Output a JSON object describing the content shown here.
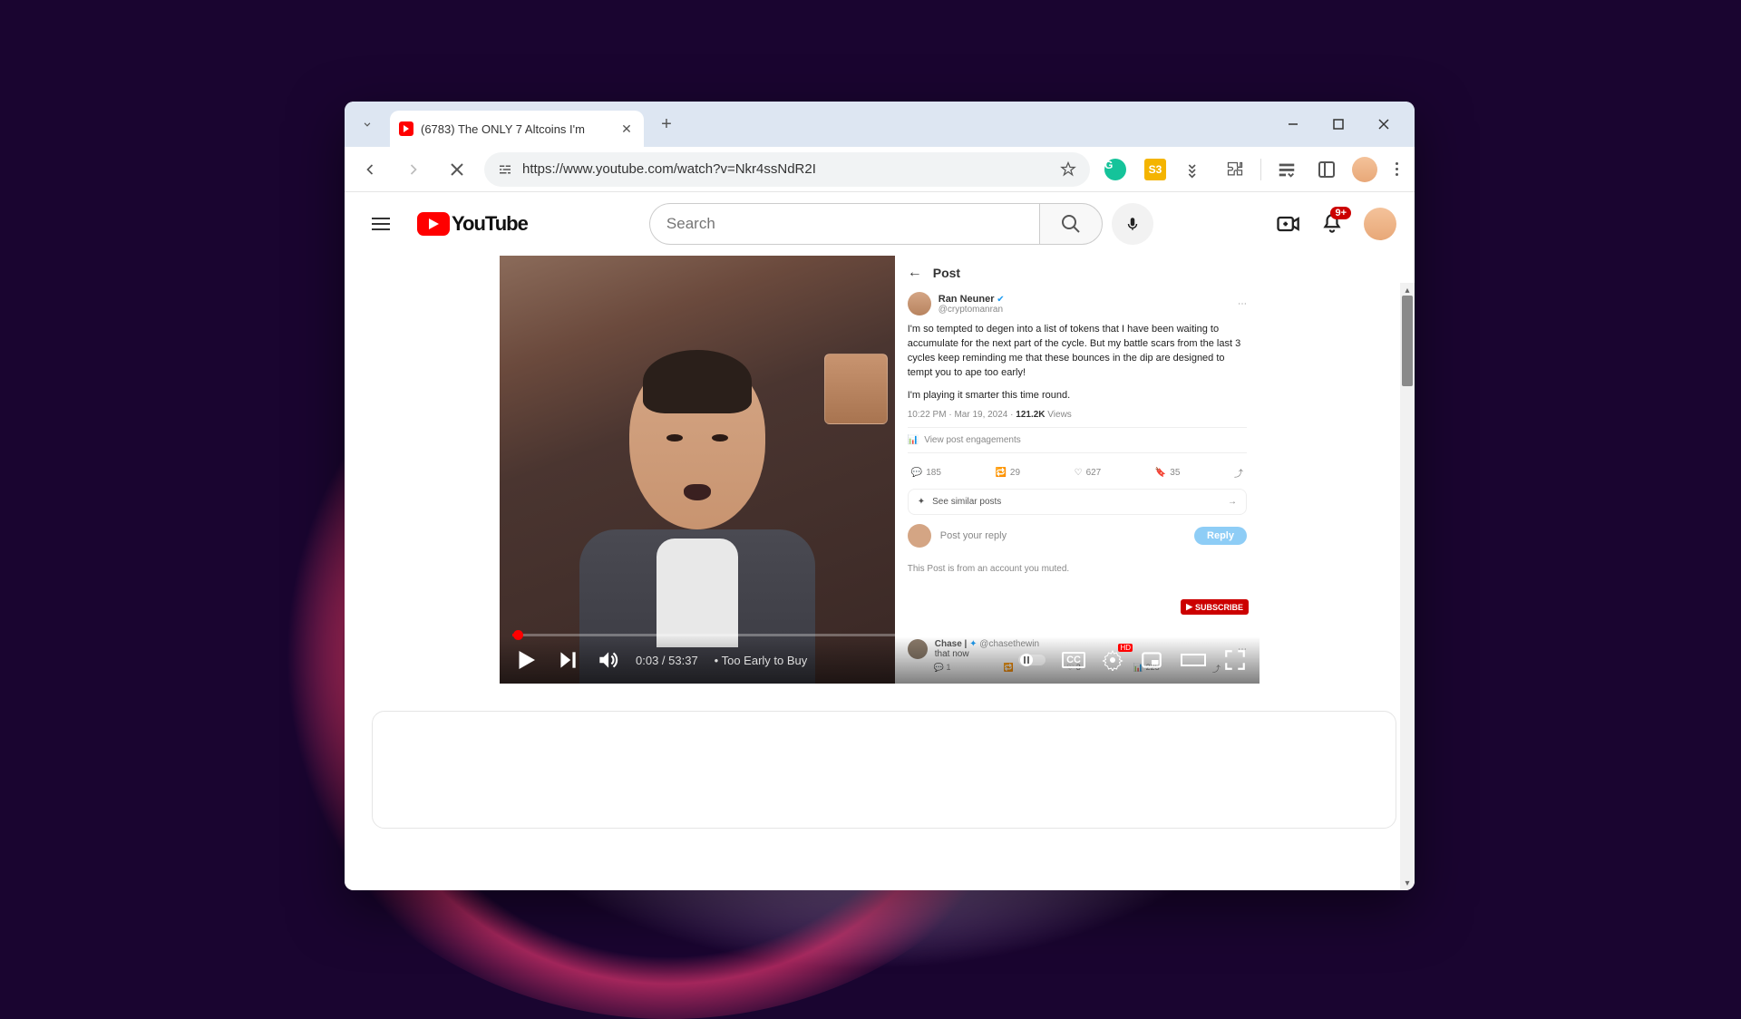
{
  "browser": {
    "tab_title": "(6783) The ONLY 7 Altcoins I'm",
    "url": "https://www.youtube.com/watch?v=Nkr4ssNdR2I"
  },
  "youtube": {
    "logo_text": "YouTube",
    "search_placeholder": "Search",
    "notif_badge": "9+"
  },
  "player": {
    "current_time": "0:03",
    "duration": "53:37",
    "time_combined": "0:03 / 53:37",
    "chapter": "• Too Early to Buy",
    "hd_label": "HD",
    "cc_label": "CC"
  },
  "tweet": {
    "header": "Post",
    "author_name": "Ran Neuner",
    "author_handle": "@cryptomanran",
    "body1": "I'm so tempted to degen into a list of tokens that I have been waiting to accumulate for the next part of the cycle. But my battle scars from the last 3 cycles keep reminding me that these bounces in the dip are designed to tempt you to ape too early!",
    "body2": "I'm playing it smarter this time round.",
    "time": "10:22 PM · Mar 19, 2024",
    "views_count": "121.2K",
    "views_label": " Views",
    "engagements": "View post engagements",
    "replies": "185",
    "retweets": "29",
    "likes": "627",
    "bookmarks": "35",
    "similar": "See similar posts",
    "reply_placeholder": "Post your reply",
    "reply_btn": "Reply",
    "muted_notice": "This Post is from an account you muted.",
    "subscribe": "SUBSCRIBE",
    "comment_author": "Chase | ",
    "comment_handle": "@chasethewin",
    "comment_text": "that  now",
    "comment_like": "225"
  }
}
